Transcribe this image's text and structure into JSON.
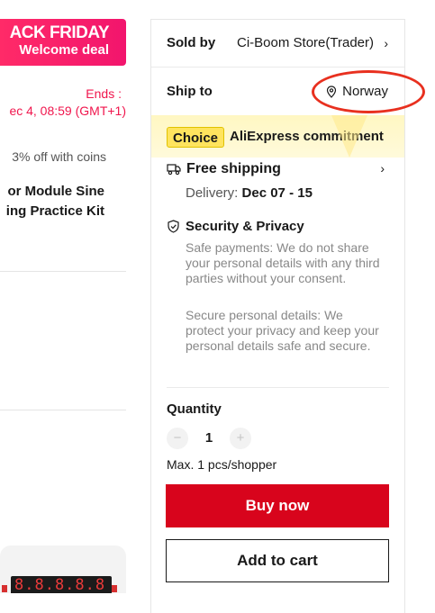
{
  "promo": {
    "banner_line1": "ACK FRIDAY",
    "banner_line2": "Welcome deal",
    "ends_label": "Ends :",
    "ends_time": "ec 4, 08:59 (GMT+1)",
    "coins_text": "3% off with coins",
    "colors": {
      "banner": "#f2156d",
      "ends_text": "#f0164d"
    }
  },
  "product": {
    "title_line1": "or Module Sine",
    "title_line2": "ing Practice Kit",
    "thumbnail_digits": "8.8.8.8.8"
  },
  "seller": {
    "sold_by_label": "Sold by",
    "store_name": "Ci-Boom Store(Trader)",
    "chevron": "›"
  },
  "shipping": {
    "ship_to_label": "Ship to",
    "country": "Norway",
    "icon": "location-pin-icon"
  },
  "commitment": {
    "badge": "Choice",
    "text": "AliExpress commitment",
    "colors": {
      "band": "#fff7c2",
      "badge": "#ffe45e"
    }
  },
  "free_shipping": {
    "title": "Free shipping",
    "icon": "truck-icon",
    "delivery_label": "Delivery:",
    "delivery_dates": "Dec 07 - 15",
    "chevron": "›"
  },
  "security": {
    "title": "Security & Privacy",
    "icon": "shield-check-icon",
    "safe_payments": "Safe payments: We do not share your personal details with any third parties without your consent.",
    "secure_details": "Secure personal details: We protect your privacy and keep your personal details safe and secure."
  },
  "quantity": {
    "label": "Quantity",
    "minus": "−",
    "value": "1",
    "plus": "+",
    "max_text": "Max. 1 pcs/shopper"
  },
  "actions": {
    "buy_now": "Buy now",
    "add_to_cart": "Add to cart",
    "colors": {
      "buy_now": "#d8041c"
    }
  },
  "annotation": {
    "color": "#e8301f"
  }
}
